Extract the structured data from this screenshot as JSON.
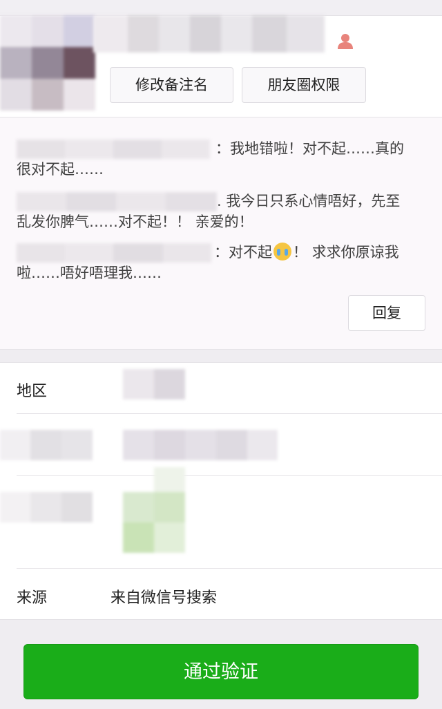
{
  "profile": {
    "remark_button": "修改备注名",
    "moments_permission_button": "朋友圈权限",
    "gender_icon": "person-icon",
    "gender_color": "#e8847c"
  },
  "messages": [
    {
      "text_line1": "：我地错啦！对不起……真的",
      "text_line2": "很对不起……"
    },
    {
      "text_line1": ". 我今日只系心情唔好，先至",
      "text_line2": "乱发你脾气……对不起！！ 亲爱的！"
    },
    {
      "text_line1_a": "：对不起",
      "text_line1_b": "！ 求求你原谅我",
      "text_line2": "啦……唔好唔理我……",
      "emoji": "crying-face-icon"
    }
  ],
  "reply_button": "回复",
  "info": {
    "region_label": "地区",
    "source_label": "来源",
    "source_value": "来自微信号搜索"
  },
  "verify_button": "通过验证",
  "colors": {
    "accent_green": "#1aad19",
    "background": "#efedf1"
  }
}
